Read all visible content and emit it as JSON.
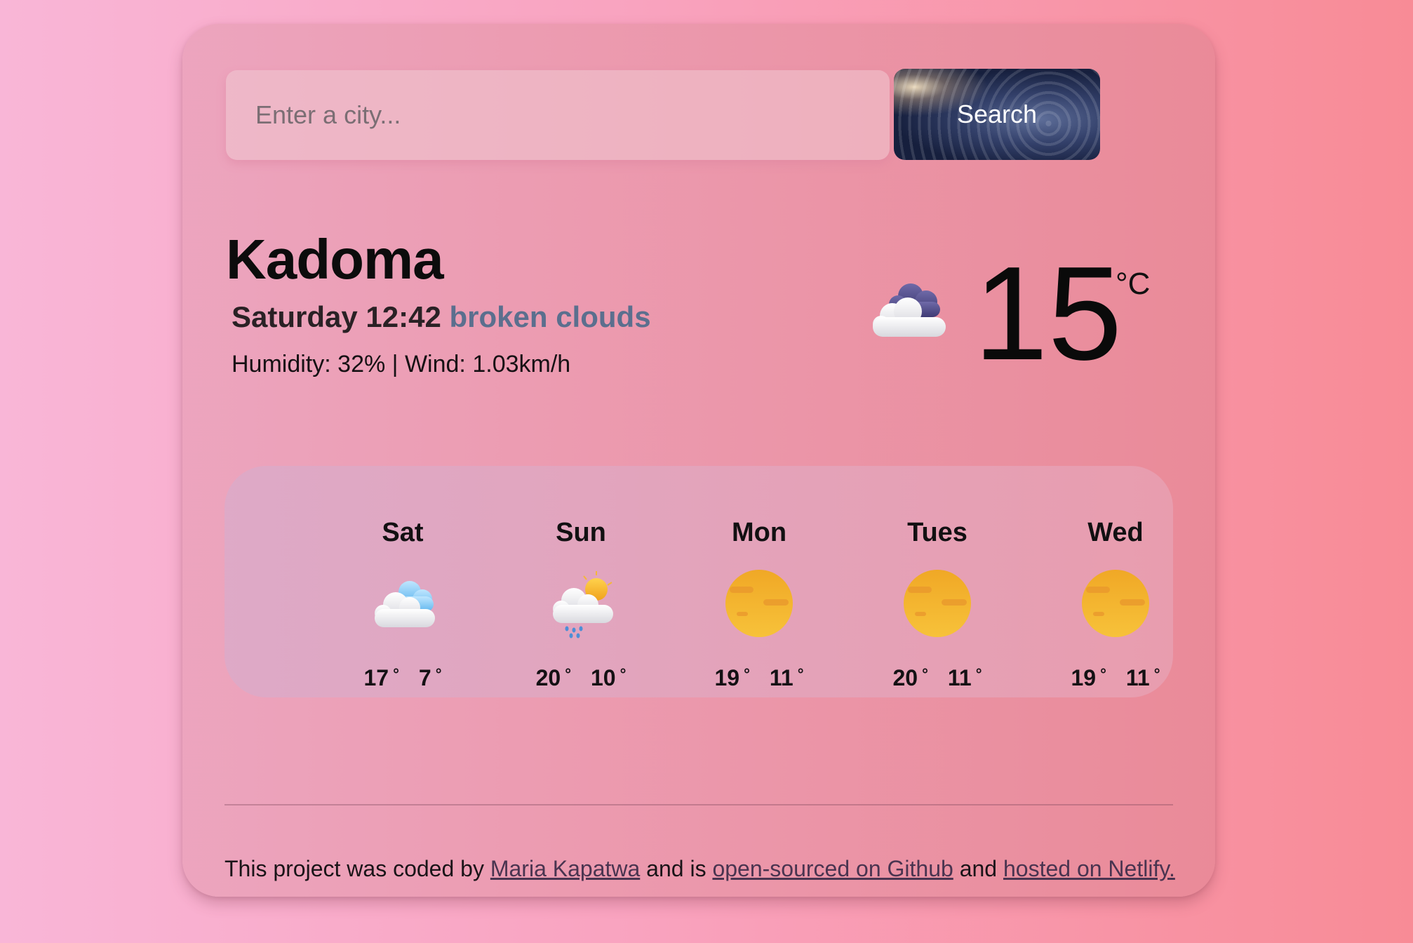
{
  "search": {
    "placeholder": "Enter a city...",
    "button_label": "Search"
  },
  "current": {
    "city": "Kadoma",
    "datetime": "Saturday 12:42",
    "description": "broken clouds",
    "humidity_label": "Humidity:",
    "humidity_value": "32%",
    "separator": "|",
    "wind_label": "Wind:",
    "wind_value": "1.03km/h",
    "temperature": "15",
    "unit": "°C",
    "icon": "broken-clouds-icon"
  },
  "forecast": [
    {
      "day": "Sat",
      "max": "17",
      "min": "7",
      "deg": "°",
      "icon": "cloudy-icon"
    },
    {
      "day": "Sun",
      "max": "20",
      "min": "10",
      "deg": "°",
      "icon": "rain-sun-icon"
    },
    {
      "day": "Mon",
      "max": "19",
      "min": "11",
      "deg": "°",
      "icon": "hazy-sun-icon"
    },
    {
      "day": "Tues",
      "max": "20",
      "min": "11",
      "deg": "°",
      "icon": "hazy-sun-icon"
    },
    {
      "day": "Wed",
      "max": "19",
      "min": "11",
      "deg": "°",
      "icon": "hazy-sun-icon"
    }
  ],
  "footer": {
    "text1": "This project was coded by",
    "author": "Maria Kapatwa",
    "text2": "and is",
    "github_link": "open-sourced on Github",
    "text3": "and",
    "netlify_link": "hosted on Netlify."
  },
  "colors": {
    "description": "#5b6f8e",
    "link": "#4a3450",
    "sun": "#f3b52a"
  }
}
